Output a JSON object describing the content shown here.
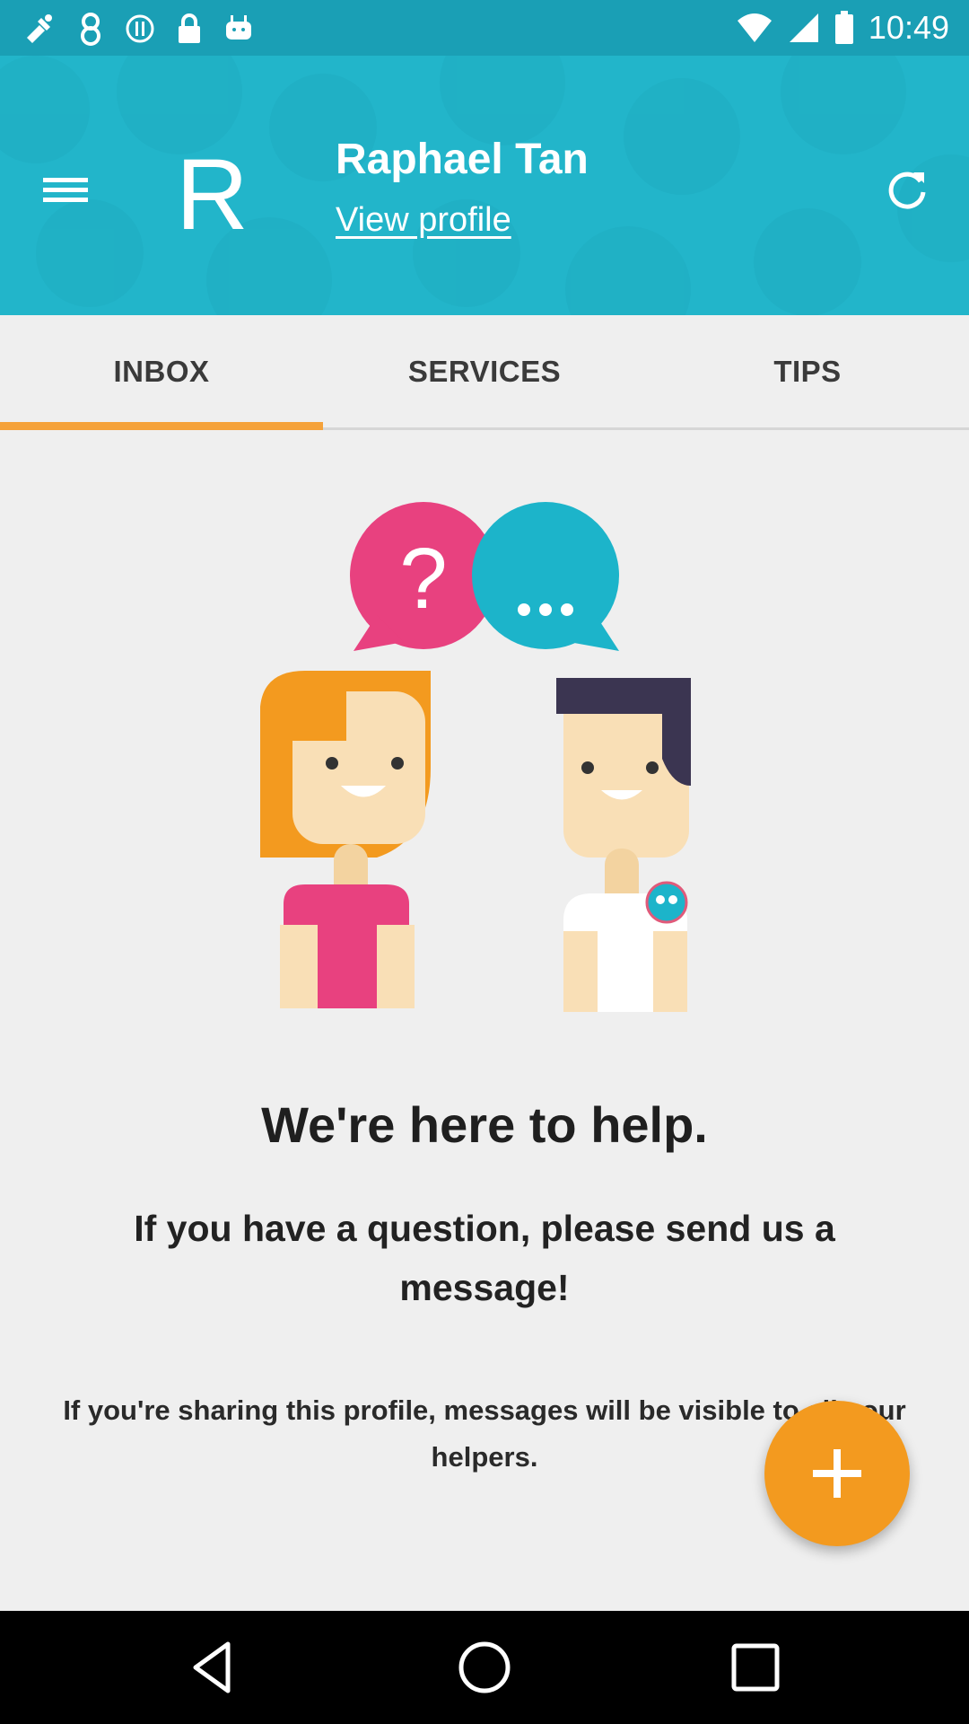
{
  "status_bar": {
    "time": "10:49",
    "left_icons": [
      "fake-gps-icon",
      "notification-icon",
      "sync-icon",
      "lock-icon",
      "android-icon"
    ],
    "right_icons": [
      "wifi-icon",
      "signal-icon",
      "battery-icon"
    ]
  },
  "header": {
    "avatar_letter": "R",
    "user_name": "Raphael Tan",
    "view_profile_label": "View profile",
    "background_color": "#22b5ca"
  },
  "tabs": [
    {
      "label": "INBOX",
      "active": true
    },
    {
      "label": "SERVICES",
      "active": false
    },
    {
      "label": "TIPS",
      "active": false
    }
  ],
  "empty_state": {
    "headline": "We're here to help.",
    "subline": "If you have a question, please send us a message!",
    "note": "If you're sharing this profile, messages will be visible to all your helpers."
  },
  "fab": {
    "icon": "plus-icon",
    "color": "#f39a1f"
  },
  "nav_bar": {
    "buttons": [
      "back-icon",
      "home-icon",
      "recents-icon"
    ]
  },
  "colors": {
    "accent": "#f5a23a",
    "question_bubble": "#e8417f",
    "chat_bubble": "#1cb4ca"
  }
}
